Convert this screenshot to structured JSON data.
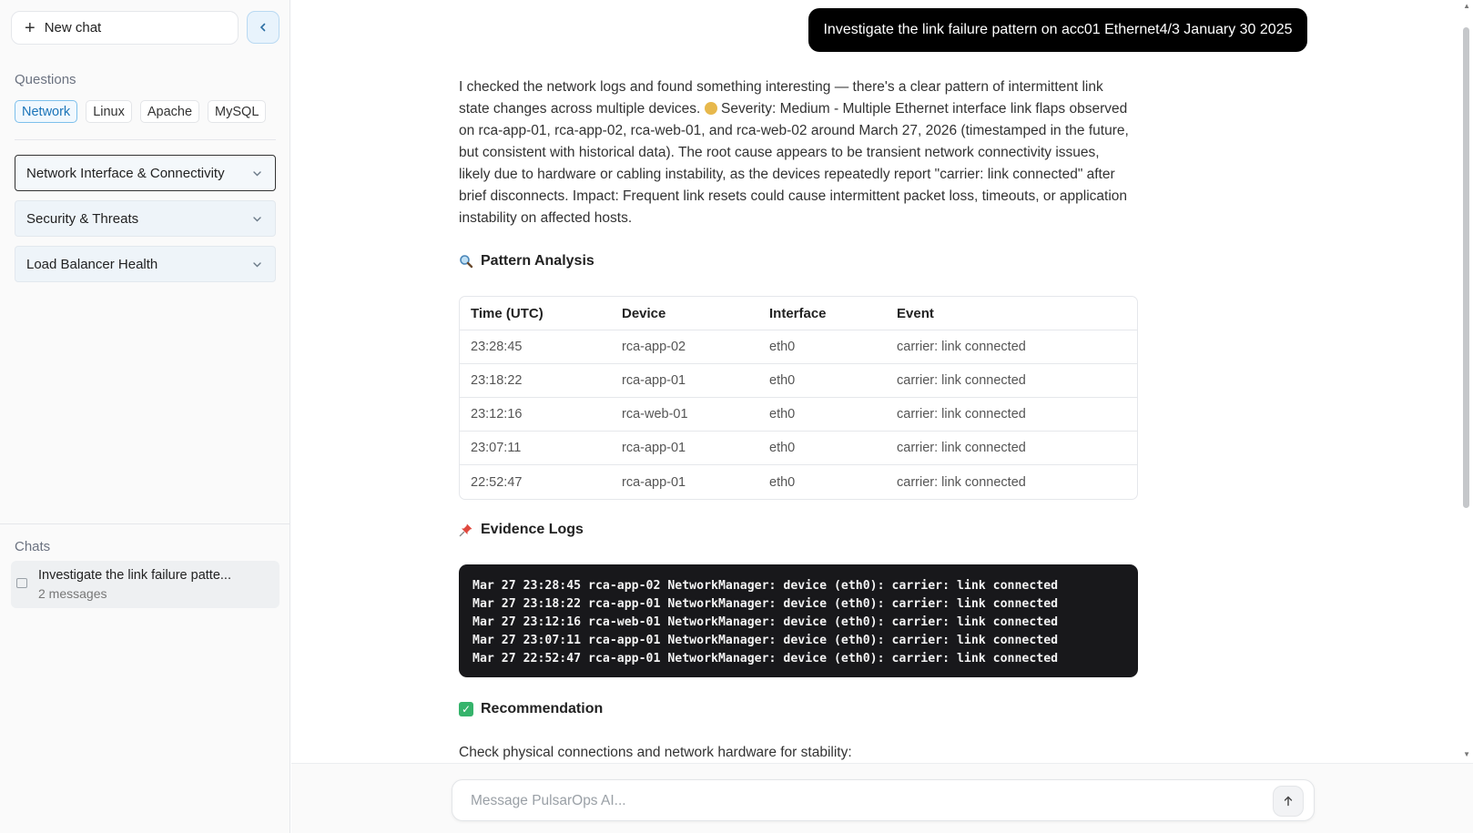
{
  "sidebar": {
    "new_chat_label": "New chat",
    "questions_title": "Questions",
    "chips": [
      "Network",
      "Linux",
      "Apache",
      "MySQL"
    ],
    "active_chip": "Network",
    "accordions": [
      "Network Interface & Connectivity",
      "Security & Threats",
      "Load Balancer Health"
    ],
    "chats_title": "Chats",
    "chats": [
      {
        "title": "Investigate the link failure patte...",
        "subtitle": "2 messages"
      }
    ]
  },
  "conversation": {
    "user_message": "Investigate the link failure pattern on acc01 Ethernet4/3 January 30 2025",
    "answer_intro": "I checked the network logs and found something interesting — there's a clear pattern of intermittent link state changes across multiple devices.",
    "answer_body": "Severity: Medium - Multiple Ethernet interface link flaps observed on rca-app-01, rca-app-02, rca-web-01, and rca-web-02 around March 27, 2026 (timestamped in the future, but consistent with historical data). The root cause appears to be transient network connectivity issues, likely due to hardware or cabling instability, as the devices repeatedly report \"carrier: link connected\" after brief disconnects. Impact: Frequent link resets could cause intermittent packet loss, timeouts, or application instability on affected hosts.",
    "pattern_heading": "Pattern Analysis",
    "table": {
      "headers": [
        "Time (UTC)",
        "Device",
        "Interface",
        "Event"
      ],
      "rows": [
        [
          "23:28:45",
          "rca-app-02",
          "eth0",
          "carrier: link connected"
        ],
        [
          "23:18:22",
          "rca-app-01",
          "eth0",
          "carrier: link connected"
        ],
        [
          "23:12:16",
          "rca-web-01",
          "eth0",
          "carrier: link connected"
        ],
        [
          "23:07:11",
          "rca-app-01",
          "eth0",
          "carrier: link connected"
        ],
        [
          "22:52:47",
          "rca-app-01",
          "eth0",
          "carrier: link connected"
        ]
      ]
    },
    "evidence_heading": "Evidence Logs",
    "logs": [
      "Mar 27 23:28:45 rca-app-02 NetworkManager: device (eth0): carrier: link connected",
      "Mar 27 23:18:22 rca-app-01 NetworkManager: device (eth0): carrier: link connected",
      "Mar 27 23:12:16 rca-web-01 NetworkManager: device (eth0): carrier: link connected",
      "Mar 27 23:07:11 rca-app-01 NetworkManager: device (eth0): carrier: link connected",
      "Mar 27 22:52:47 rca-app-01 NetworkManager: device (eth0): carrier: link connected"
    ],
    "recommendation_heading": "Recommendation",
    "recommendation_text": "Check physical connections and network hardware for stability:"
  },
  "composer": {
    "placeholder": "Message PulsarOps AI..."
  },
  "icons": {
    "new_chat": "plus-icon",
    "collapse": "chevron-left-icon",
    "accordion": "chevron-down-icon",
    "chat": "chat-bubble-icon",
    "pattern": "magnifier-icon",
    "evidence": "pushpin-icon",
    "recommendation": "check-box-icon",
    "send": "arrow-up-icon"
  },
  "colors": {
    "accent": "#1b74b8",
    "user_bubble": "#000000",
    "code_bg": "#18181b",
    "severity_dot": "#e7b84c",
    "check": "#35b36b"
  }
}
